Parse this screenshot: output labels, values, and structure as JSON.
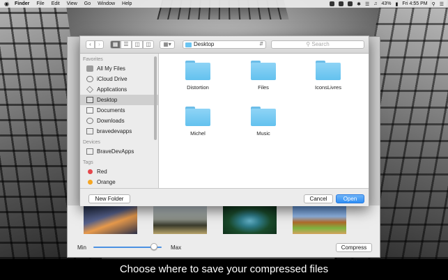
{
  "menubar": {
    "app_name": "Finder",
    "items": [
      "File",
      "Edit",
      "View",
      "Go",
      "Window",
      "Help"
    ],
    "battery": "43%",
    "clock": "Fri 4:55 PM"
  },
  "dialog": {
    "location": "Desktop",
    "search_placeholder": "Search",
    "sidebar": {
      "favorites_heading": "Favorites",
      "favorites": [
        "All My Files",
        "iCloud Drive",
        "Applications",
        "Desktop",
        "Documents",
        "Downloads",
        "bravedevapps"
      ],
      "devices_heading": "Devices",
      "devices": [
        "BraveDevApps"
      ],
      "tags_heading": "Tags",
      "tags": [
        {
          "label": "Red",
          "color": "#e5484d"
        },
        {
          "label": "Orange",
          "color": "#f5a623"
        }
      ]
    },
    "files": [
      "Distortion",
      "Files",
      "IconsLivres",
      "Michel",
      "Music"
    ],
    "new_folder_label": "New Folder",
    "cancel_label": "Cancel",
    "open_label": "Open"
  },
  "app": {
    "min_label": "Min",
    "max_label": "Max",
    "compress_label": "Compress",
    "quality_level": 0.88
  },
  "caption": "Choose where to save your compressed files",
  "colors": {
    "accent": "#2f8ff5",
    "folder": "#63c1ee"
  }
}
